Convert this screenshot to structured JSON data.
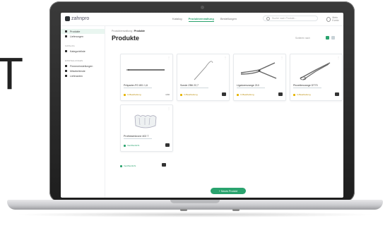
{
  "backdrop_text": "T",
  "app": {
    "logo_text": "zahnpro",
    "nav": [
      "Katalog",
      "Produktverwaltung",
      "Bestellungen"
    ],
    "nav_active_index": 1,
    "search_placeholder": "Suche nach Produkt...",
    "user_label": "Mein Konto"
  },
  "sidebar": {
    "items_top": [
      {
        "label": "Produkte",
        "icon": "box-icon",
        "active": true
      },
      {
        "label": "Lieferungen",
        "icon": "truck-icon",
        "active": false
      }
    ],
    "section_1": "KATALOG",
    "items_mid": [
      {
        "label": "Kategorieliste",
        "icon": "list-icon",
        "active": false
      }
    ],
    "section_2": "EINSTELLUNGEN",
    "items_bottom": [
      {
        "label": "Firmeneinstellungen",
        "icon": "building-icon",
        "active": false
      },
      {
        "label": "Mitarbeitende",
        "icon": "users-icon",
        "active": false
      },
      {
        "label": "Lieferanten",
        "icon": "factory-icon",
        "active": false
      }
    ]
  },
  "main": {
    "breadcrumb_root": "Produktverwaltung",
    "breadcrumb_current": "Produkte",
    "title": "Produkte",
    "sort_label": "Sortieren nach"
  },
  "products": [
    {
      "name": "Präparier-FG 801 1,6",
      "status": "In Bearbeitung",
      "status_color": "yellow",
      "price": "4,50"
    },
    {
      "name": "Sonde ZB6 22,7",
      "status": "In Bearbeitung",
      "status_color": "yellow"
    },
    {
      "name": "Ligaturenzange 210",
      "status": "In Bearbeitung",
      "status_color": "yellow"
    },
    {
      "name": "Pinzettenzange DT70",
      "status": "In Bearbeitung",
      "status_color": "yellow"
    },
    {
      "name": "Prothesenkrone 402 7",
      "status": "Veröffentlicht",
      "status_color": "green"
    }
  ],
  "extra_status": "Veröffentlicht",
  "create_button": "+ Neues Produkt",
  "colors": {
    "accent": "#2aa36e",
    "pending": "#e6b400"
  }
}
